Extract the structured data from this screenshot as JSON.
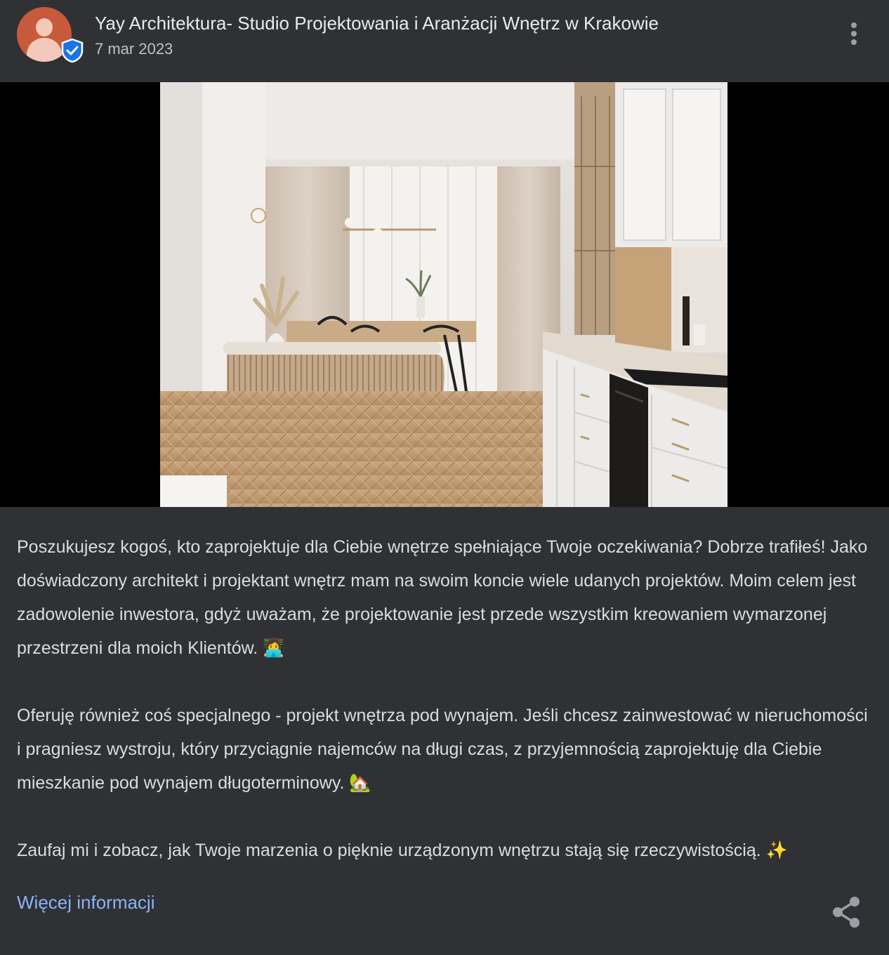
{
  "post": {
    "author": "Yay Architektura- Studio Projektowania i Aranżacji Wnętrz w Krakowie",
    "date": "7 mar 2023",
    "paragraphs": [
      "Poszukujesz kogoś, kto zaprojektuje dla Ciebie wnętrze spełniające Twoje oczekiwania? Dobrze trafiłeś! Jako doświadczony architekt i projektant wnętrz mam na swoim koncie wiele udanych projektów. Moim celem jest zadowolenie inwestora, gdyż uważam, że projektowanie jest przede wszystkim kreowaniem wymarzonej przestrzeni dla moich Klientów. 👩‍💻",
      "Oferuję również coś specjalnego - projekt wnętrza pod wynajem. Jeśli chcesz zainwestować w nieruchomości i pragniesz wystroju, który przyciągnie najemców na długi czas, z przyjemnością zaprojektuję dla Ciebie mieszkanie pod wynajem długoterminowy. 🏡",
      "Zaufaj mi i zobacz, jak Twoje marzenia o pięknie urządzonym wnętrzu stają się rzeczywistością. ✨"
    ],
    "more_link": "Więcej informacji"
  },
  "icons": {
    "avatar": "avatar-placeholder-icon",
    "verified": "verified-badge-icon",
    "menu": "more-vert-icon",
    "share": "share-icon"
  },
  "colors": {
    "background": "#303134",
    "link": "#8ab4f8",
    "avatar": "#c85a3c",
    "verified": "#1a73e8"
  }
}
